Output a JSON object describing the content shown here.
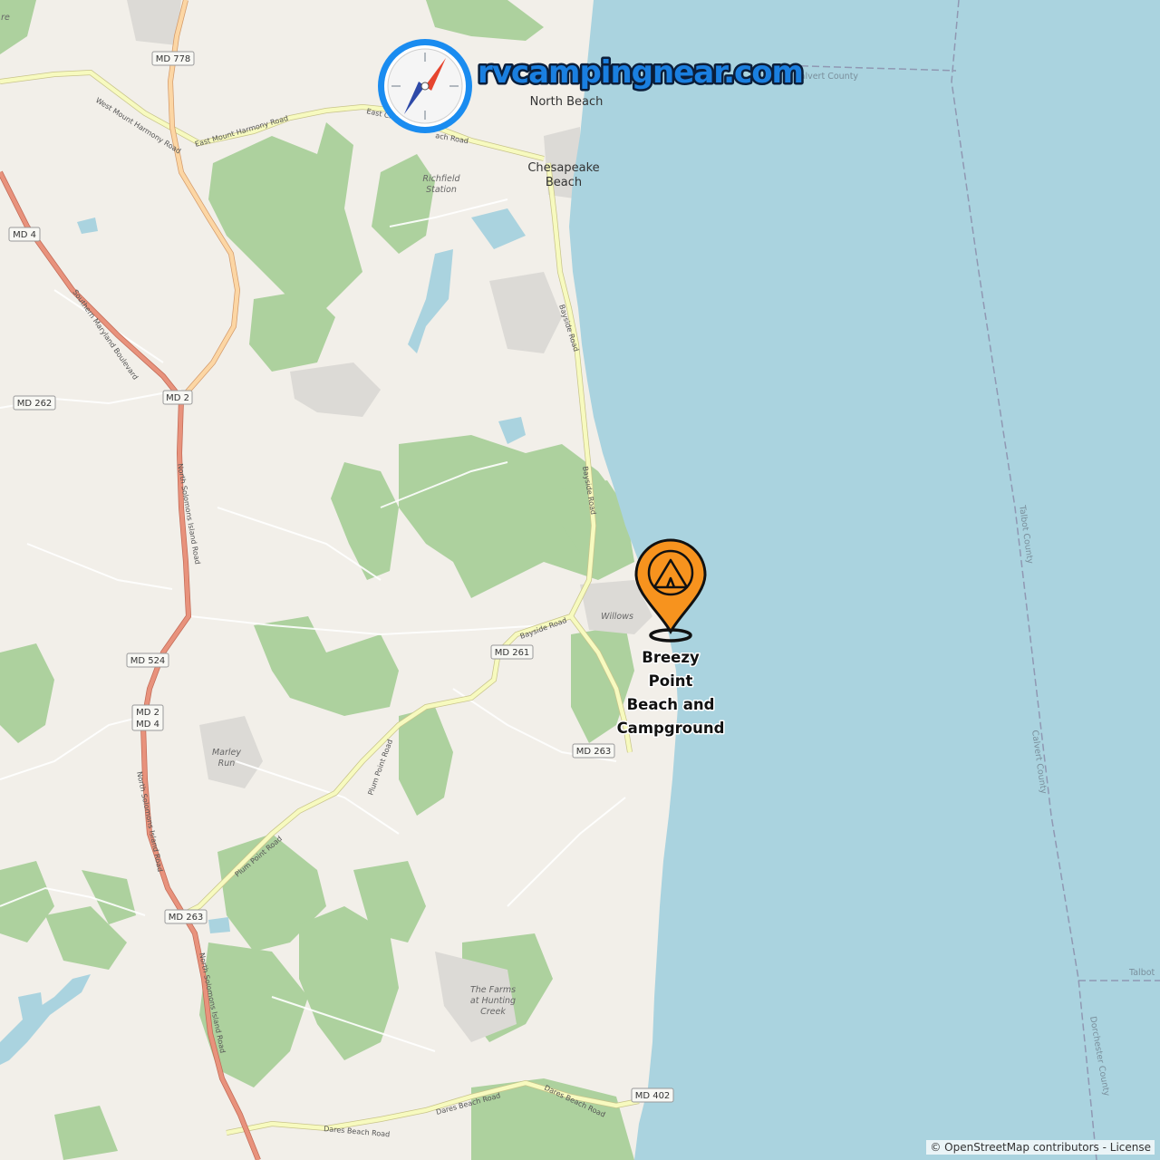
{
  "brand": {
    "site_name": "rvcampingnear.com",
    "logo_icon": "compass-icon"
  },
  "campground": {
    "name_lines": [
      "Breezy",
      "Point",
      "Beach and",
      "Campground"
    ],
    "marker_icon": "tent-pin-icon",
    "marker_color": "#f7931e"
  },
  "places": {
    "north_beach": "North Beach",
    "chesapeake_beach_line1": "Chesapeake",
    "chesapeake_beach_line2": "Beach",
    "richfield_line1": "Richfield",
    "richfield_line2": "Station",
    "willows": "Willows",
    "marley_line1": "Marley",
    "marley_line2": "Run",
    "farms_line1": "The Farms",
    "farms_line2": "at Hunting",
    "farms_line3": "Creek"
  },
  "shields": {
    "md778": "MD 778",
    "md4": "MD 4",
    "md262": "MD 262",
    "md2": "MD 2",
    "md524": "MD 524",
    "md2b": "MD 2",
    "md4b": "MD 4",
    "md261": "MD 261",
    "md263a": "MD 263",
    "md263b": "MD 263",
    "md402": "MD 402"
  },
  "roads": {
    "west_mount_harmony": "West Mount Harmony Road",
    "east_mount_harmony": "East Mount Harmony Road",
    "east_chesapeake_a": "East Ch",
    "east_chesapeake_b": "ach Road",
    "southern_maryland": "Southern Maryland Boulevard",
    "bayside_1": "Bayside Road",
    "bayside_2": "Bayside Road",
    "bayside_3": "Bayside Road",
    "north_solomons_1": "North Solomons Island Road",
    "north_solomons_2": "North Solomons Island Road",
    "north_solomons_3": "North Solomons Island Road",
    "plum_point_1": "Plum Point Road",
    "plum_point_2": "Plum Point Road",
    "dares_beach_1": "Dares Beach Road",
    "dares_beach_2": "Dares Beach Road",
    "dares_beach_3": "Dares Beach Road"
  },
  "water_labels": {
    "calvert_top": "Calvert County",
    "calvert_right": "Calvert County",
    "talbot_right": "Talbot County",
    "talbot_edge": "Talbot",
    "dorchester": "Dorchester County"
  },
  "edge_text": "re",
  "attribution": "© OpenStreetMap contributors - License",
  "colors": {
    "water": "#aad3df",
    "land": "#f2efe9",
    "forest": "#add19e",
    "primary_road": "#f4b58b",
    "trunk_road": "#e8927c",
    "secondary_road": "#f6f9be",
    "brand_blue": "#1a7fe0"
  }
}
